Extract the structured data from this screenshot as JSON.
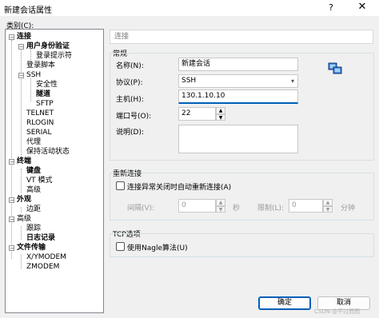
{
  "window": {
    "title": "新建会话属性",
    "help": "?",
    "close": "✕"
  },
  "category_label": "类别(C):",
  "tree": [
    {
      "label": "连接",
      "bold": true
    },
    {
      "label": "用户身份验证",
      "bold": true
    },
    {
      "label": "登录提示符",
      "bold": false
    },
    {
      "label": "登录脚本",
      "bold": false
    },
    {
      "label": "SSH",
      "bold": false
    },
    {
      "label": "安全性",
      "bold": false
    },
    {
      "label": "隧道",
      "bold": true
    },
    {
      "label": "SFTP",
      "bold": false
    },
    {
      "label": "TELNET",
      "bold": false
    },
    {
      "label": "RLOGIN",
      "bold": false
    },
    {
      "label": "SERIAL",
      "bold": false
    },
    {
      "label": "代理",
      "bold": false
    },
    {
      "label": "保持活动状态",
      "bold": false
    },
    {
      "label": "终端",
      "bold": true
    },
    {
      "label": "键盘",
      "bold": true
    },
    {
      "label": "VT 模式",
      "bold": false
    },
    {
      "label": "高级",
      "bold": false
    },
    {
      "label": "外观",
      "bold": true
    },
    {
      "label": "边距",
      "bold": false
    },
    {
      "label": "高级",
      "bold": false
    },
    {
      "label": "跟踪",
      "bold": false
    },
    {
      "label": "日志记录",
      "bold": true
    },
    {
      "label": "文件传输",
      "bold": true
    },
    {
      "label": "X/YMODEM",
      "bold": false
    },
    {
      "label": "ZMODEM",
      "bold": false
    }
  ],
  "section_header": "连接",
  "general": {
    "title": "常规",
    "name_label": "名称(N):",
    "name_value": "新建会话",
    "protocol_label": "协议(P):",
    "protocol_value": "SSH",
    "host_label": "主机(H):",
    "host_value": "130.1.10.10",
    "port_label": "端口号(O):",
    "port_value": "22",
    "desc_label": "说明(D):",
    "desc_value": ""
  },
  "reconnect": {
    "title": "重新连接",
    "checkbox_label": "连接异常关闭时自动重新连接(A)",
    "interval_label": "间隔(V):",
    "interval_value": "0",
    "interval_unit": "秒",
    "limit_label": "限制(L):",
    "limit_value": "0",
    "limit_unit": "分钟"
  },
  "tcp": {
    "title": "TCP选项",
    "checkbox_label": "使用Nagle算法(U)"
  },
  "buttons": {
    "ok": "确定",
    "cancel": "取消"
  },
  "watermark": "CSDN @不过而而",
  "icons": [
    "help-icon",
    "close-icon",
    "network-icon",
    "dropdown-arrow-icon",
    "spin-up-icon",
    "spin-down-icon"
  ]
}
